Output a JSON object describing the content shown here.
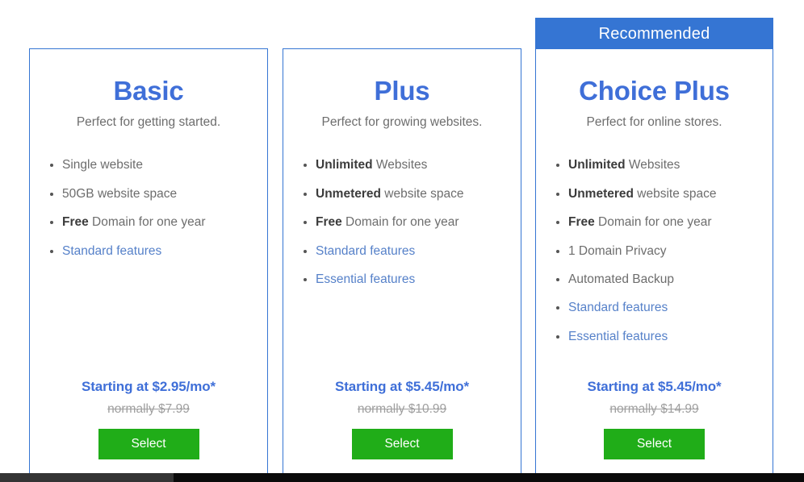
{
  "recommended_banner": {
    "label": "Recommended",
    "color": "#3575d3"
  },
  "colors": {
    "accent_blue": "#3f6fd8",
    "banner_blue": "#3575d3",
    "link_blue": "#5681c9",
    "button_green": "#20ad18",
    "body_gray": "#6d6d6d",
    "strike_gray": "#9f9f9f"
  },
  "plans": [
    {
      "id": "basic",
      "title": "Basic",
      "tagline": "Perfect for getting started.",
      "features": [
        {
          "strong": "",
          "text": "Single website",
          "is_link": false
        },
        {
          "strong": "",
          "text": "50GB website space",
          "is_link": false
        },
        {
          "strong": "Free",
          "text": " Domain for one year",
          "is_link": false
        },
        {
          "strong": "",
          "text": "Standard features",
          "is_link": true
        }
      ],
      "price_main": "Starting at $2.95/mo*",
      "price_was": "normally $7.99",
      "select_label": "Select"
    },
    {
      "id": "plus",
      "title": "Plus",
      "tagline": "Perfect for growing websites.",
      "features": [
        {
          "strong": "Unlimited",
          "text": " Websites",
          "is_link": false
        },
        {
          "strong": "Unmetered",
          "text": " website space",
          "is_link": false
        },
        {
          "strong": "Free",
          "text": " Domain for one year",
          "is_link": false
        },
        {
          "strong": "",
          "text": "Standard features",
          "is_link": true
        },
        {
          "strong": "",
          "text": "Essential features",
          "is_link": true
        }
      ],
      "price_main": "Starting at $5.45/mo*",
      "price_was": "normally $10.99",
      "select_label": "Select"
    },
    {
      "id": "choice-plus",
      "title": "Choice Plus",
      "tagline": "Perfect for online stores.",
      "features": [
        {
          "strong": "Unlimited",
          "text": " Websites",
          "is_link": false
        },
        {
          "strong": "Unmetered",
          "text": " website space",
          "is_link": false
        },
        {
          "strong": "Free",
          "text": " Domain for one year",
          "is_link": false
        },
        {
          "strong": "",
          "text": "1 Domain Privacy",
          "is_link": false
        },
        {
          "strong": "",
          "text": "Automated Backup",
          "is_link": false
        },
        {
          "strong": "",
          "text": "Standard features",
          "is_link": true
        },
        {
          "strong": "",
          "text": "Essential features",
          "is_link": true
        }
      ],
      "price_main": "Starting at $5.45/mo*",
      "price_was": "normally $14.99",
      "select_label": "Select"
    }
  ]
}
